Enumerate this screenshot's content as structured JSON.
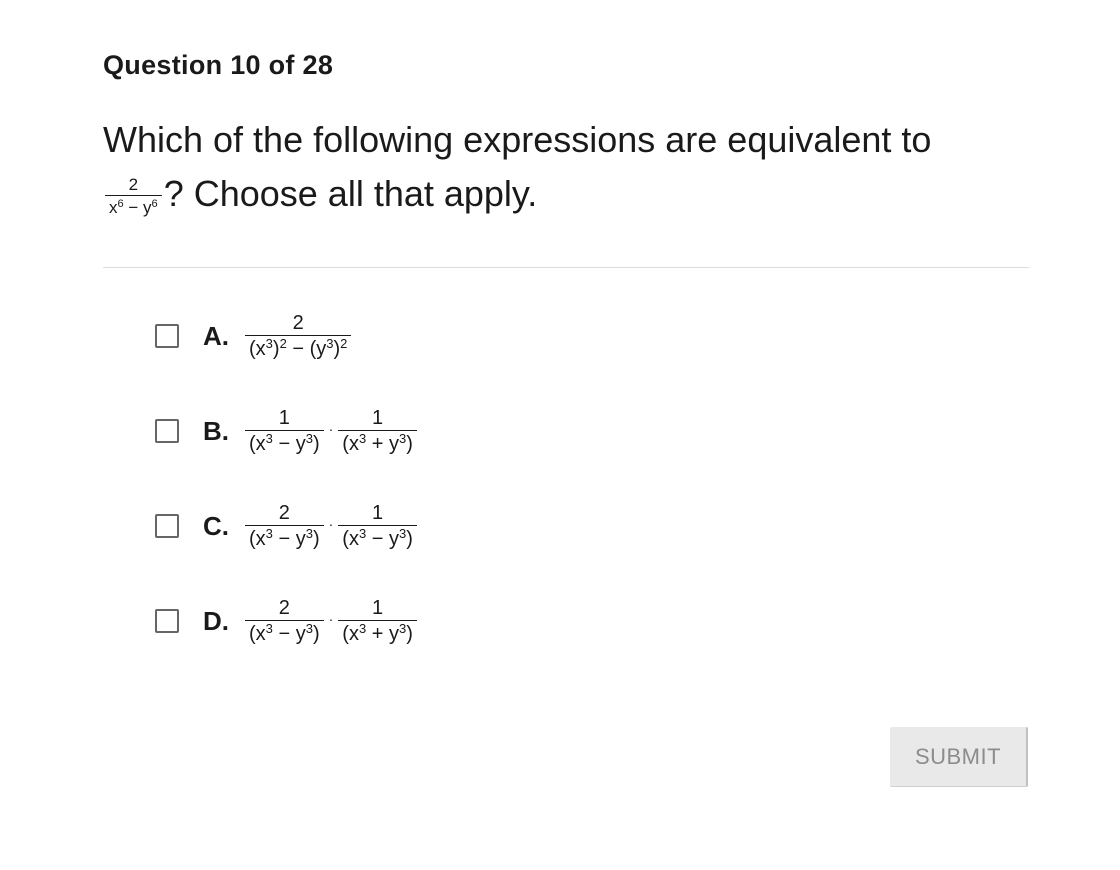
{
  "question": {
    "counter": "Question 10 of 28",
    "text_before": "Which of the following expressions are equivalent to",
    "fraction": {
      "numerator": "2",
      "denominator_parts": [
        "x",
        "6",
        " − y",
        "6"
      ]
    },
    "text_after": "? Choose all that apply."
  },
  "options": [
    {
      "letter": "A.",
      "terms": [
        {
          "num": "2",
          "den": [
            "(x",
            "3",
            ")",
            "2",
            " − (y",
            "3",
            ")",
            "2"
          ]
        }
      ]
    },
    {
      "letter": "B.",
      "terms": [
        {
          "num": "1",
          "den": [
            "(x",
            "3",
            " − y",
            "3",
            ")"
          ]
        },
        {
          "num": "1",
          "den": [
            "(x",
            "3",
            " + y",
            "3",
            ")"
          ]
        }
      ]
    },
    {
      "letter": "C.",
      "terms": [
        {
          "num": "2",
          "den": [
            "(x",
            "3",
            " − y",
            "3",
            ")"
          ]
        },
        {
          "num": "1",
          "den": [
            "(x",
            "3",
            " − y",
            "3",
            ")"
          ]
        }
      ]
    },
    {
      "letter": "D.",
      "terms": [
        {
          "num": "2",
          "den": [
            "(x",
            "3",
            " − y",
            "3",
            ")"
          ]
        },
        {
          "num": "1",
          "den": [
            "(x",
            "3",
            " + y",
            "3",
            ")"
          ]
        }
      ]
    }
  ],
  "operator": "·",
  "submit_label": "SUBMIT"
}
